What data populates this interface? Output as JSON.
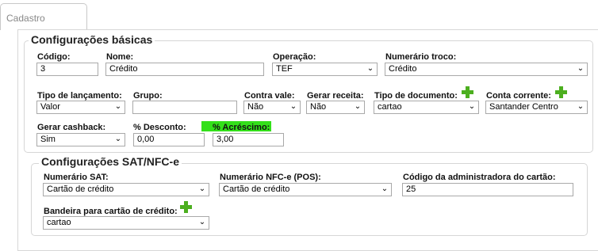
{
  "tab": {
    "label": "Cadastro"
  },
  "section_basic": {
    "title": "Configurações básicas",
    "codigo": {
      "label": "Código:",
      "value": "3"
    },
    "nome": {
      "label": "Nome:",
      "value": "Crédito"
    },
    "operacao": {
      "label": "Operação:",
      "value": "TEF"
    },
    "numerario_troco": {
      "label": "Numerário troco:",
      "value": "Crédito"
    },
    "tipo_lancamento": {
      "label": "Tipo de lançamento:",
      "value": "Valor"
    },
    "grupo": {
      "label": "Grupo:",
      "value": ""
    },
    "contra_vale": {
      "label": "Contra vale:",
      "value": "Não"
    },
    "gerar_receita": {
      "label": "Gerar receita:",
      "value": "Não"
    },
    "tipo_documento": {
      "label": "Tipo de documento:",
      "value": "cartao"
    },
    "conta_corrente": {
      "label": "Conta corrente:",
      "value": "Santander Centro"
    },
    "gerar_cashback": {
      "label": "Gerar cashback:",
      "value": "Sim"
    },
    "desconto": {
      "label": "% Desconto:",
      "value": "0,00"
    },
    "acrescimo": {
      "label": "% Acréscimo:",
      "value": "3,00"
    }
  },
  "section_sat": {
    "title": "Configurações SAT/NFC-e",
    "numerario_sat": {
      "label": "Numerário SAT:",
      "value": "Cartão de crédito"
    },
    "numerario_nfce": {
      "label": "Numerário NFC-e (POS):",
      "value": "Cartão de crédito"
    },
    "codigo_administradora": {
      "label": "Código da administradora do cartão:",
      "value": "25"
    },
    "bandeira": {
      "label": "Bandeira para cartão de crédito:",
      "value": "cartao"
    }
  },
  "colors": {
    "accent_green": "#4caf1f",
    "highlight_green": "#33e01a"
  },
  "icons": {
    "add": "plus-icon",
    "dropdown": "chevron-down-icon"
  }
}
